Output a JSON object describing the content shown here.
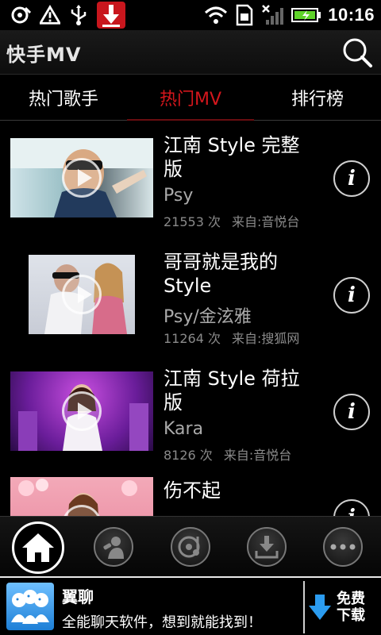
{
  "status_bar": {
    "time": "10:16",
    "icons": [
      "sync-error-icon",
      "warning-icon",
      "usb-icon",
      "download-notification-icon",
      "wifi-icon",
      "sim-icon",
      "signal-icon",
      "battery-charging-icon"
    ]
  },
  "app_bar": {
    "title": "快手MV",
    "search_icon": "search-icon"
  },
  "tabs": [
    {
      "label": "热门歌手",
      "active": false
    },
    {
      "label": "热门MV",
      "active": true
    },
    {
      "label": "排行榜",
      "active": false
    }
  ],
  "videos": [
    {
      "title": "江南 Style 完整版",
      "artist": "Psy",
      "count": "21553 次",
      "source": "来自:音悦台"
    },
    {
      "title": "哥哥就是我的Style",
      "artist": "Psy/金泫雅",
      "count": "11264 次",
      "source": "来自:搜狐网"
    },
    {
      "title": "江南 Style 荷拉版",
      "artist": "Kara",
      "count": "8126 次",
      "source": "来自:音悦台"
    },
    {
      "title": "伤不起",
      "artist": "",
      "count": "",
      "source": ""
    }
  ],
  "bottom_nav": [
    {
      "icon": "home-icon",
      "active": true
    },
    {
      "icon": "singer-icon",
      "active": false
    },
    {
      "icon": "music-disc-icon",
      "active": false
    },
    {
      "icon": "download-icon",
      "active": false
    },
    {
      "icon": "more-icon",
      "active": false
    }
  ],
  "ad": {
    "title": "翼聊",
    "description": "全能聊天软件，想到就能找到！",
    "download_label": "免费下载"
  },
  "colors": {
    "active_tab": "#d4161c",
    "background": "#000000",
    "notification_red": "#c8161d"
  }
}
